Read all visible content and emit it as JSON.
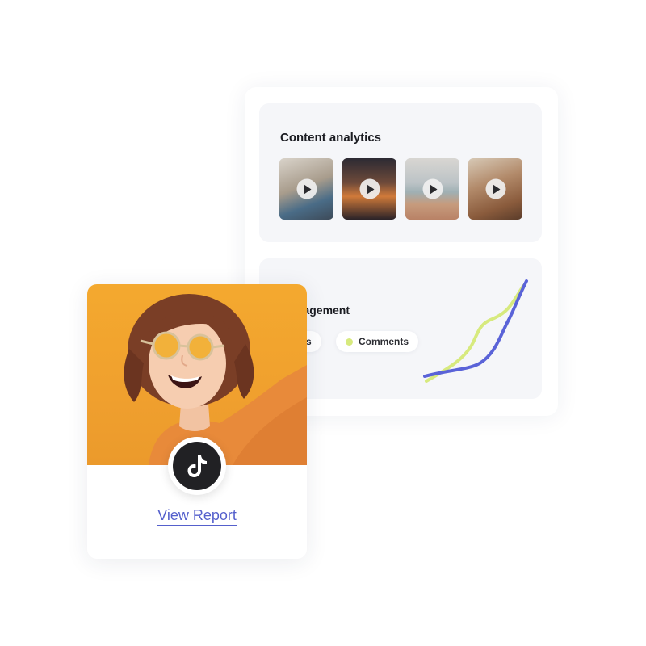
{
  "content_analytics": {
    "title": "Content analytics",
    "thumbnails": [
      {
        "name": "video-thumbnail-1",
        "icon": "play-icon"
      },
      {
        "name": "video-thumbnail-2",
        "icon": "play-icon"
      },
      {
        "name": "video-thumbnail-3",
        "icon": "play-icon"
      },
      {
        "name": "video-thumbnail-4",
        "icon": "play-icon"
      }
    ]
  },
  "engagement": {
    "title": "Engagement",
    "chips": [
      {
        "label": "Likes",
        "color": "#5a63d8"
      },
      {
        "label": "Comments",
        "color": "#d7ea7e"
      }
    ]
  },
  "profile_card": {
    "platform_icon": "tiktok-icon",
    "action_label": "View Report"
  },
  "colors": {
    "accent": "#5560cc",
    "line_blue": "#5a63d8",
    "line_lime": "#d7ea7e",
    "photo_background": "#f2a42f"
  }
}
